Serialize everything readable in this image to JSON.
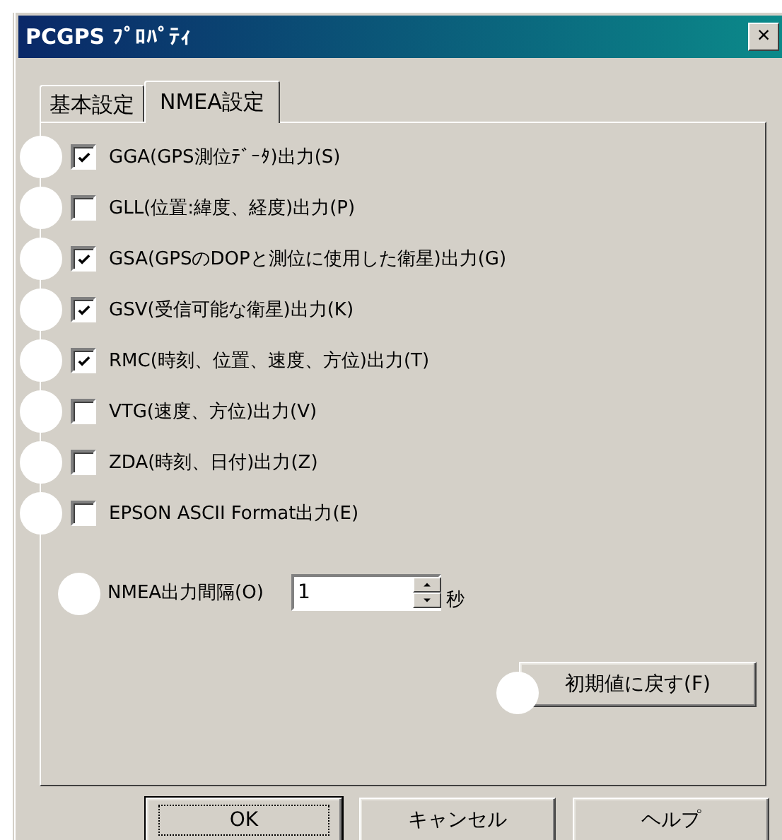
{
  "window": {
    "title": "PCGPS ﾌﾟﾛﾊﾟﾃｨ",
    "close": "×"
  },
  "tabs": [
    {
      "label": "基本設定",
      "selected": false
    },
    {
      "label": "NMEA設定",
      "selected": true
    }
  ],
  "options": [
    {
      "label": "GGA(GPS測位ﾃﾞｰﾀ)出力(S)",
      "checked": true,
      "marker": true
    },
    {
      "label": "GLL(位置:緯度、経度)出力(P)",
      "checked": false,
      "marker": true
    },
    {
      "label": "GSA(GPSのDOPと測位に使用した衛星)出力(G)",
      "checked": true,
      "marker": true
    },
    {
      "label": "GSV(受信可能な衛星)出力(K)",
      "checked": true,
      "marker": true
    },
    {
      "label": "RMC(時刻、位置、速度、方位)出力(T)",
      "checked": true,
      "marker": true
    },
    {
      "label": "VTG(速度、方位)出力(V)",
      "checked": false,
      "marker": true
    },
    {
      "label": "ZDA(時刻、日付)出力(Z)",
      "checked": false,
      "marker": true
    },
    {
      "label": "EPSON ASCII Format出力(E)",
      "checked": false,
      "marker": true
    }
  ],
  "interval": {
    "label": "NMEA出力間隔(O)",
    "value": "1",
    "unit": "秒",
    "marker": true
  },
  "reset_button": {
    "label": "初期値に戻す(F)",
    "marker": true
  },
  "buttons": [
    {
      "label": "OK",
      "default": true
    },
    {
      "label": "キャンセル",
      "default": false
    },
    {
      "label": "ヘルプ",
      "default": false
    }
  ]
}
